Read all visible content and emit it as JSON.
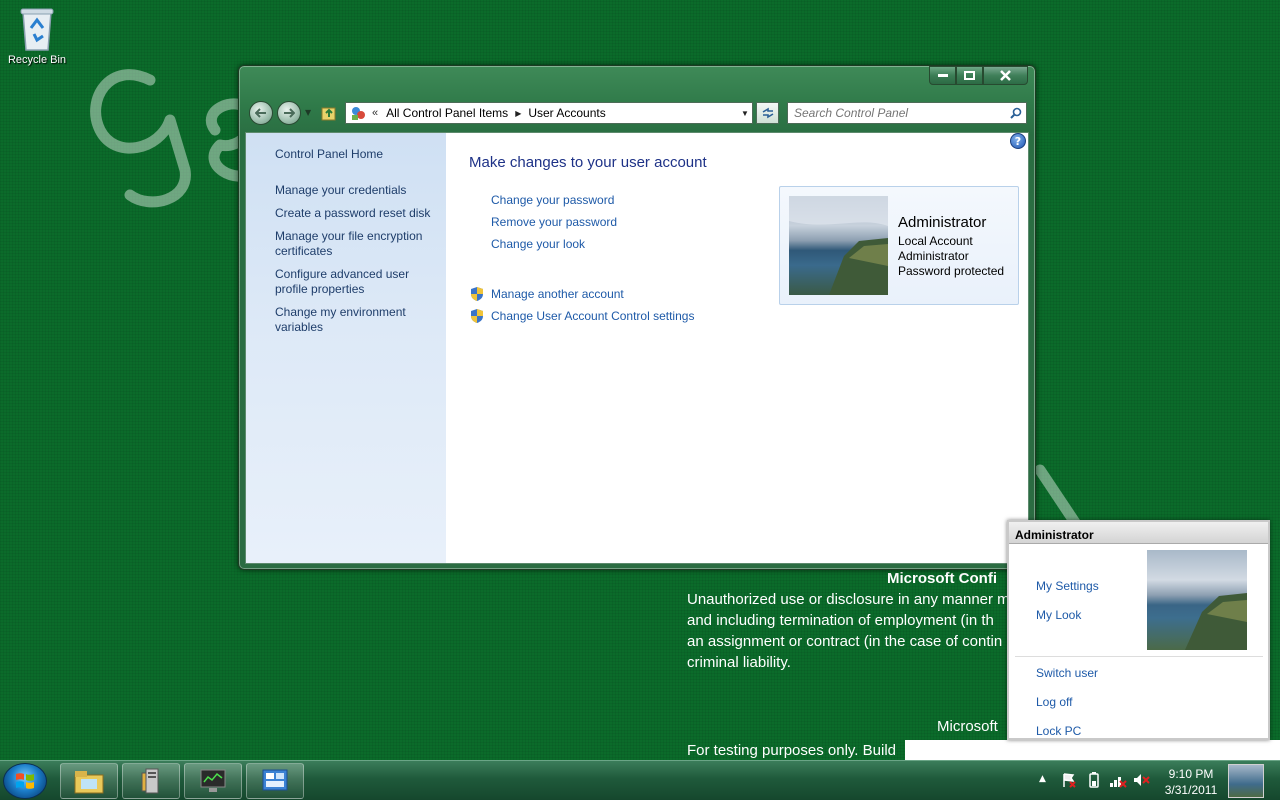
{
  "desktop": {
    "recycle_bin_label": "Recycle Bin",
    "background_text": {
      "title": "Microsoft Confi",
      "lines": [
        "Unauthorized use or disclosure in any manner m",
        "and including termination of employment (in th",
        "an assignment or contract (in the case of contin",
        "criminal liability."
      ],
      "microsoft": "Microsoft",
      "build": "For testing purposes only. Build"
    }
  },
  "window": {
    "breadcrumb": {
      "overflow": "«",
      "items": [
        "All Control Panel Items",
        "User Accounts"
      ]
    },
    "search_placeholder": "Search Control Panel",
    "left_pane": {
      "home": "Control Panel Home",
      "links": [
        "Manage your credentials",
        "Create a password reset disk",
        "Manage your file encryption certificates",
        "Configure advanced user profile properties",
        "Change my environment variables"
      ]
    },
    "main": {
      "title": "Make changes to your user account",
      "tasks": [
        "Change your password",
        "Remove your password",
        "Change your look"
      ],
      "shield_tasks": [
        "Manage another account",
        "Change User Account Control settings"
      ]
    },
    "account": {
      "name": "Administrator",
      "lines": [
        "Local Account",
        "Administrator",
        "Password protected"
      ]
    }
  },
  "user_menu": {
    "header": "Administrator",
    "links_top": [
      "My Settings",
      "My Look"
    ],
    "links_bottom": [
      "Switch user",
      "Log off",
      "Lock PC"
    ]
  },
  "taskbar": {
    "time": "9:10 PM",
    "date": "3/31/2011"
  },
  "colors": {
    "desktop_green": "#0b6b2a",
    "link_blue": "#1e5aa8",
    "title_blue": "#1e3287"
  }
}
